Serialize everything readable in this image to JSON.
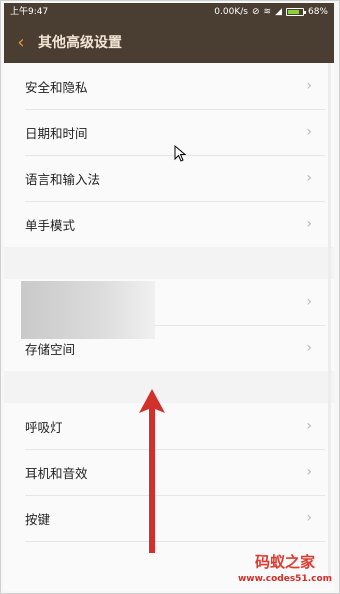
{
  "status_bar": {
    "time": "上午9:47",
    "network_speed": "0.00K/s",
    "battery": "68%",
    "icons": [
      "silent-icon",
      "wifi-icon",
      "signal-icon",
      "battery-icon"
    ]
  },
  "header": {
    "title": "其他高级设置",
    "back_icon": "chevron-left-icon"
  },
  "list": {
    "items": [
      {
        "label": "安全和隐私"
      },
      {
        "label": "日期和时间"
      },
      {
        "label": "语言和输入法"
      },
      {
        "label": "单手模式"
      },
      {
        "label": ""
      },
      {
        "label": "存储空间"
      },
      {
        "label": "呼吸灯"
      },
      {
        "label": "耳机和音效"
      },
      {
        "label": "按键"
      }
    ]
  },
  "watermark": {
    "name": "码蚁之家",
    "url": "www.codes51.com"
  },
  "colors": {
    "header_bg": "#4a3d31",
    "accent": "#e59a3a",
    "annotation_arrow": "#d0312d"
  }
}
